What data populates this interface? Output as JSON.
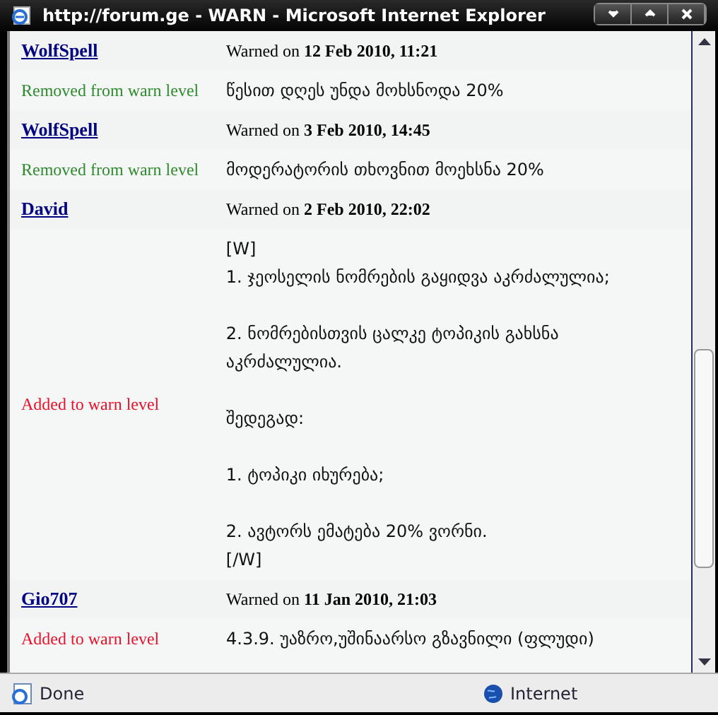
{
  "window": {
    "title": "http://forum.ge - WARN - Microsoft Internet Explorer"
  },
  "entries": [
    {
      "user": "WolfSpell",
      "warned": "Warned on **12 Feb 2010, 11:21**",
      "action": {
        "kind": "removed",
        "label": "Removed from warn level"
      },
      "reason": [
        [
          "წესით დღეს უნდა მოხსნოდა 20%"
        ]
      ]
    },
    {
      "user": "WolfSpell",
      "warned": "Warned on **3 Feb 2010, 14:45**",
      "action": {
        "kind": "removed",
        "label": "Removed from warn level"
      },
      "reason": [
        [
          "მოდერატორის თხოვნით მოეხსნა 20%"
        ]
      ]
    },
    {
      "user": "David",
      "warned": "Warned on **2 Feb 2010, 22:02**",
      "action": {
        "kind": "added",
        "label": "Added to warn level"
      },
      "reason": [
        [
          "[W]",
          "1. ჯეოსელის ნომრების გაყიდვა აკრძალულია;"
        ],
        [
          "2. ნომრებისთვის ცალკე ტოპიკის გახსნა აკრძალულია."
        ],
        [
          "შედეგად:"
        ],
        [
          "1. ტოპიკი იხურება;"
        ],
        [
          "2. ავტორს ემატება 20% ვორნი.",
          "[/W]"
        ]
      ]
    },
    {
      "user": "Gio707",
      "warned": "Warned on **11 Jan 2010, 21:03**",
      "action": {
        "kind": "added",
        "label": "Added to warn level"
      },
      "reason": [
        [
          "4.3.9. უაზრო,უშინაარსო გზავნილი (ფლუდი)"
        ]
      ]
    }
  ],
  "status_bar": {
    "status": "Done",
    "zone": "Internet"
  }
}
